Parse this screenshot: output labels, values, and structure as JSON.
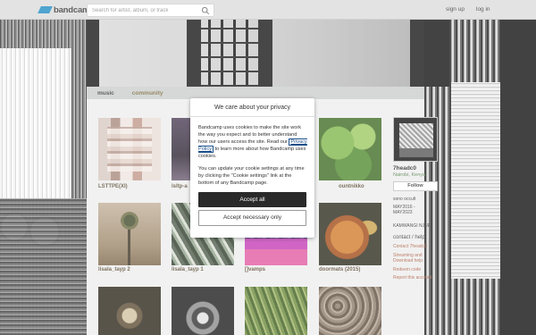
{
  "topbar": {
    "logo_text": "bandcamp",
    "search_placeholder": "Search for artist, album, or track",
    "signup": "sign up",
    "login": "log in"
  },
  "tabs": {
    "music": "music",
    "community": "community"
  },
  "albums": [
    {
      "title": "LSTTPE(XI)"
    },
    {
      "title": "lsltp-a"
    },
    {
      "title": ""
    },
    {
      "title": "ountnikko"
    },
    {
      "title": "lisala_tayp 2"
    },
    {
      "title": "lisala_tayp 1"
    },
    {
      "title": "[]vamps"
    },
    {
      "title": "doormats (2015)"
    }
  ],
  "sidebar": {
    "artist": "7headc0",
    "location": "Nairobi, Kenya",
    "follow": "Follow",
    "label": "sono occult",
    "date_range": "MAY2016 - MAY2023",
    "name": "KAMWANGI NJUE",
    "contact_heading": "contact / help",
    "contact_link": "Contact 7headc0",
    "streaming_link": "Streaming and Download help",
    "redeem_link": "Redeem code",
    "report_link": "Report this account"
  },
  "cookie_modal": {
    "title": "We care about your privacy",
    "para1_before": "Bandcamp uses cookies to make the site work the way you expect and to better understand how our users access the site. Read our ",
    "privacy_link": "Privacy Policy",
    "para1_after": " to learn more about how Bandcamp uses cookies.",
    "para2": "You can update your cookie settings at any time by clicking the \"Cookie settings\" link at the bottom of any Bandcamp page.",
    "accept_all": "Accept all",
    "accept_necessary": "Accept necessary only"
  },
  "colors": {
    "brand": "#1e8bc3",
    "accept_button": "#2a2a2a",
    "location_text": "#4f7f4a",
    "link_text": "#a85a3e"
  }
}
